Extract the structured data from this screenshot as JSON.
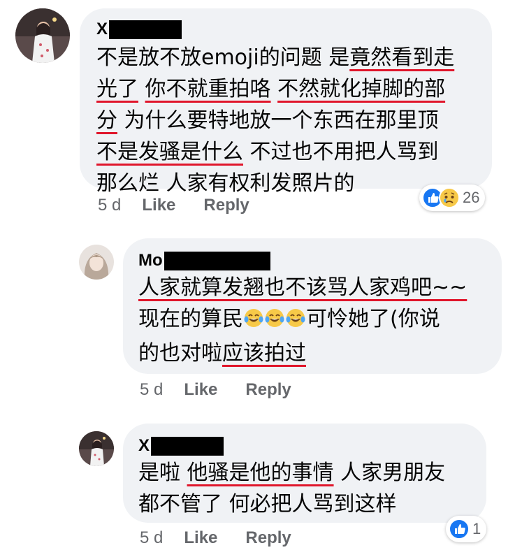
{
  "comments": [
    {
      "author": "X",
      "text": [
        {
          "t": "不是放不放emoji的问题 是",
          "u": false
        },
        {
          "t": "竟然看到走",
          "u": true
        },
        {
          "t": "\n",
          "u": false
        },
        {
          "t": "光了",
          "u": true
        },
        {
          "t": " ",
          "u": false
        },
        {
          "t": "你不就重拍咯",
          "u": true
        },
        {
          "t": " ",
          "u": false
        },
        {
          "t": "不然就化掉脚的部",
          "u": true
        },
        {
          "t": "\n",
          "u": false
        },
        {
          "t": "分",
          "u": true
        },
        {
          "t": " 为什么要特地放一个东西在那里顶",
          "u": false
        },
        {
          "t": "\n",
          "u": false
        },
        {
          "t": "不是发骚是什么",
          "u": true
        },
        {
          "t": " 不过也不用把人骂到",
          "u": false
        },
        {
          "t": "\n",
          "u": false
        },
        {
          "t": "那么烂 人家有权利发照片的",
          "u": false
        }
      ],
      "time": "5 d",
      "like": "Like",
      "reply": "Reply",
      "reaction_count": "26",
      "reactions": [
        "like-icon",
        "sad-face-icon"
      ]
    },
    {
      "author": "Mo",
      "text": [
        {
          "t": "人家就算发翘也不该骂人家鸡吧~~",
          "u": true
        },
        {
          "t": "\n",
          "u": false
        },
        {
          "t": "现在的算民",
          "u": false
        },
        {
          "t": "[E]",
          "u": false
        },
        {
          "t": "可怜她了(你说",
          "u": false
        },
        {
          "t": "\n",
          "u": false
        },
        {
          "t": "的也对啦",
          "u": false
        },
        {
          "t": "应该拍过",
          "u": true
        }
      ],
      "time": "5 d",
      "like": "Like",
      "reply": "Reply"
    },
    {
      "author": "X",
      "text": [
        {
          "t": "是啦 ",
          "u": false
        },
        {
          "t": "他骚是他的事情",
          "u": true
        },
        {
          "t": " 人家男朋友",
          "u": false
        },
        {
          "t": "\n",
          "u": false
        },
        {
          "t": "都不管了 何必把人骂到这样",
          "u": false
        }
      ],
      "time": "5 d",
      "like": "Like",
      "reply": "Reply",
      "reaction_count": "1",
      "reactions": [
        "like-icon"
      ]
    }
  ],
  "colors": {
    "bubble": "#f0f2f5",
    "underline": "#e0162b",
    "like_blue": "#1877f2",
    "meta": "#65676b"
  }
}
